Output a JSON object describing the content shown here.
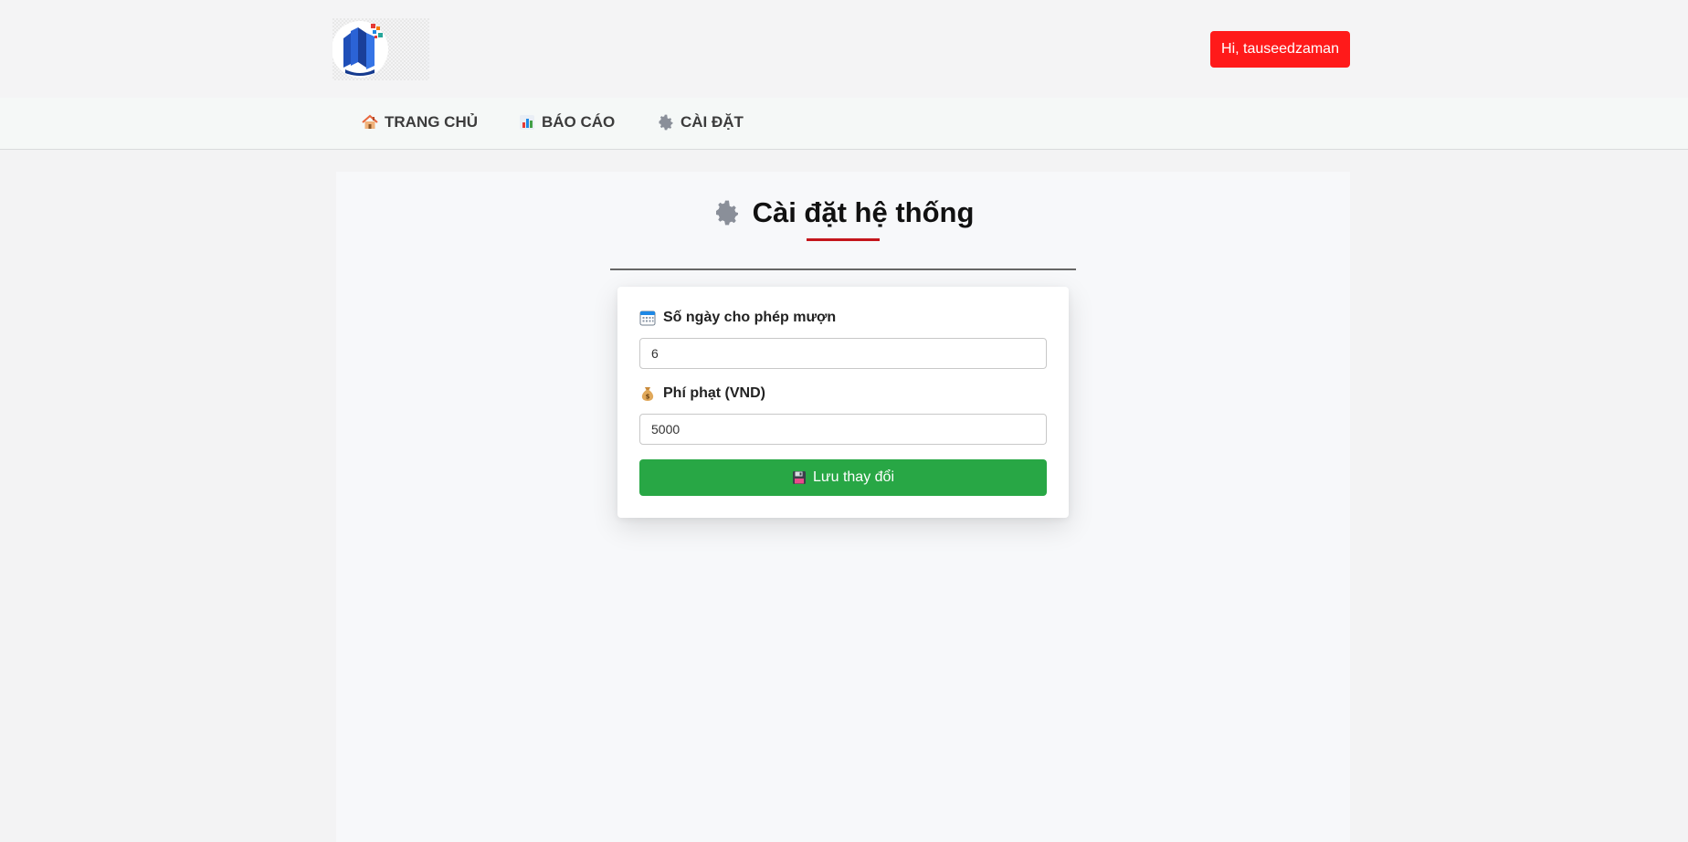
{
  "header": {
    "user_greeting": "Hi, tauseedzaman",
    "logo_icon": "library-book-logo"
  },
  "nav": {
    "items": [
      {
        "icon": "house-icon",
        "label": "TRANG CHỦ"
      },
      {
        "icon": "bar-chart-icon",
        "label": "BÁO CÁO"
      },
      {
        "icon": "gear-icon",
        "label": "CÀI ĐẶT"
      }
    ]
  },
  "settings": {
    "title": "Cài đặt hệ thống",
    "title_icon": "gear-icon",
    "fields": [
      {
        "icon": "calendar-icon",
        "label": "Số ngày cho phép mượn",
        "value": "6"
      },
      {
        "icon": "money-bag-icon",
        "label": "Phí phạt (VND)",
        "value": "5000"
      }
    ],
    "save_icon": "floppy-disk-icon",
    "save_label": "Lưu thay đổi"
  },
  "colors": {
    "accent_red": "#ff1a1a",
    "title_underline": "#c4161c",
    "save_green": "#28a745"
  }
}
